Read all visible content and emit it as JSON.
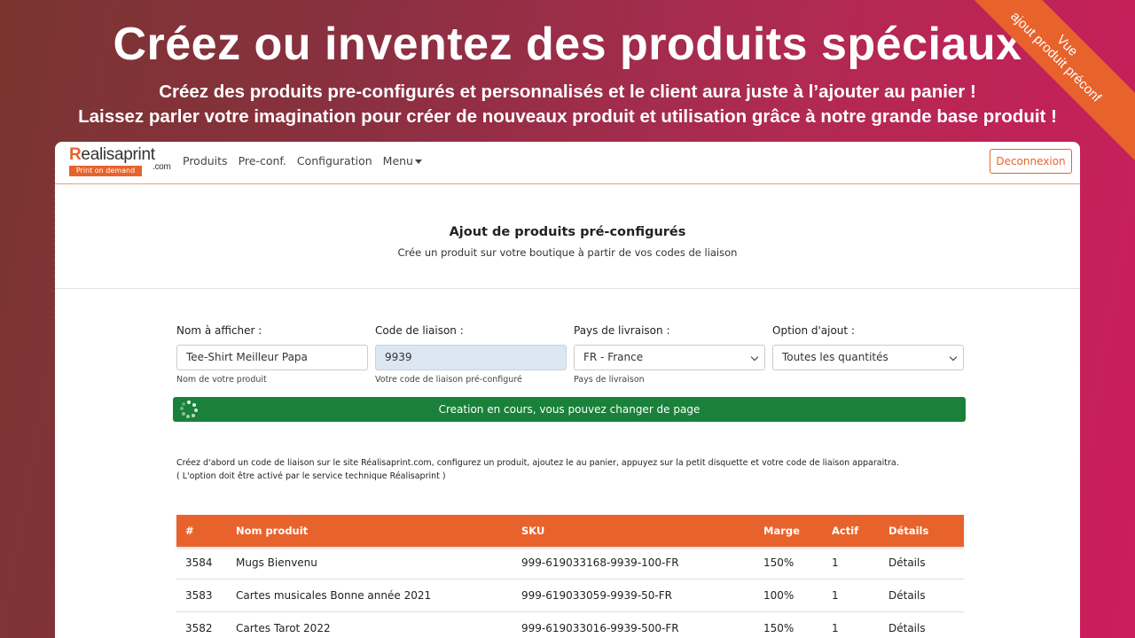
{
  "hero": {
    "title": "Créez ou inventez des produits spéciaux",
    "subtitle_1": "Créez des produits pre-configurés et personnalisés et le client aura juste à l’ajouter au panier !",
    "subtitle_2": "Laissez parler votre imagination pour créer de nouveaux produit et utilisation grâce à notre grande base produit !"
  },
  "ribbon": {
    "line_1": "Vue",
    "line_2": "ajout produit préconf"
  },
  "navbar": {
    "logo_text": "ealisaprint",
    "logo_letter": "R",
    "logo_suffix": ".com",
    "logo_tagline": "Print on demand",
    "links": [
      "Produits",
      "Pre-conf.",
      "Configuration",
      "Menu"
    ],
    "logout_label": "Deconnexion"
  },
  "page": {
    "title": "Ajout de produits pré-configurés",
    "subtitle": "Crée un produit sur votre boutique à partir de vos codes de liaison"
  },
  "form": {
    "name": {
      "label": "Nom à afficher :",
      "value": "Tee-Shirt Meilleur Papa",
      "help": "Nom de votre produit"
    },
    "code": {
      "label": "Code de liaison :",
      "value": "9939",
      "help": "Votre code de liaison pré-configuré"
    },
    "country": {
      "label": "Pays de livraison :",
      "value": "FR - France",
      "help": "Pays de livraison"
    },
    "option": {
      "label": "Option d'ajout :",
      "value": "Toutes les quantités"
    }
  },
  "progress": {
    "text": "Creation en cours, vous pouvez changer de page"
  },
  "note": {
    "line_1": "Créez d'abord un code de liaison sur le site Réalisaprint.com, configurez un produit, ajoutez le au panier, appuyez sur la petit disquette et votre code de liaison apparaitra.",
    "line_2": "( L'option doit être activé par le service technique Réalisaprint )"
  },
  "table": {
    "headers": [
      "#",
      "Nom produit",
      "SKU",
      "Marge",
      "Actif",
      "Détails"
    ],
    "rows": [
      [
        "3584",
        "Mugs Bienvenu",
        "999-619033168-9939-100-FR",
        "150%",
        "1",
        "Détails"
      ],
      [
        "3583",
        "Cartes musicales Bonne année 2021",
        "999-619033059-9939-50-FR",
        "100%",
        "1",
        "Détails"
      ],
      [
        "3582",
        "Cartes Tarot 2022",
        "999-619033016-9939-500-FR",
        "150%",
        "1",
        "Détails"
      ]
    ]
  },
  "colors": {
    "accent": "#e8632c",
    "success": "#19813a"
  }
}
